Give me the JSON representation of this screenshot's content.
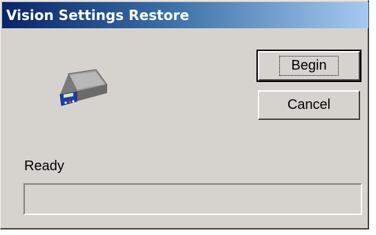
{
  "window": {
    "title": "Vision Settings Restore"
  },
  "buttons": {
    "begin_label": "Begin",
    "cancel_label": "Cancel"
  },
  "icon": {
    "name": "scale-icon"
  },
  "status": {
    "text": "Ready",
    "progress_percent": 0
  },
  "colors": {
    "titlebar_start": "#0a246a",
    "titlebar_end": "#a6caf0",
    "dialog_background": "#d6d3ce"
  }
}
